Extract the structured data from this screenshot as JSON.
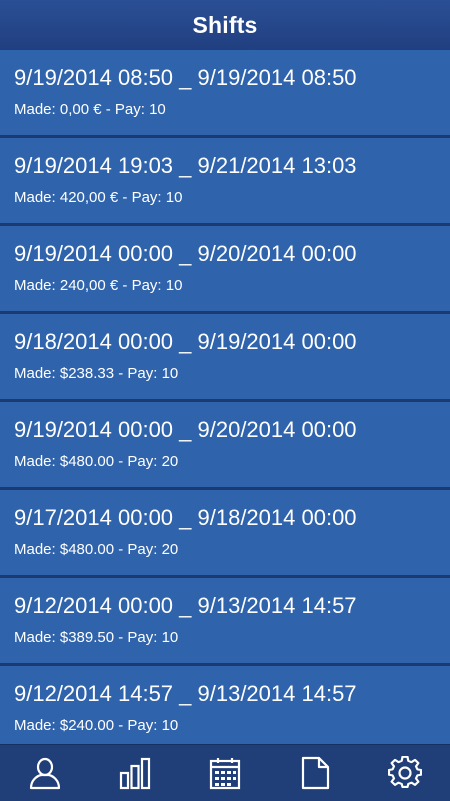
{
  "header": {
    "title": "Shifts"
  },
  "shifts": [
    {
      "range": "9/19/2014 08:50 _ 9/19/2014 08:50",
      "made": "Made: 0,00 € - Pay: 10"
    },
    {
      "range": "9/19/2014 19:03 _ 9/21/2014 13:03",
      "made": "Made: 420,00 € - Pay: 10"
    },
    {
      "range": "9/19/2014 00:00 _ 9/20/2014 00:00",
      "made": "Made: 240,00 € - Pay: 10"
    },
    {
      "range": "9/18/2014 00:00 _ 9/19/2014 00:00",
      "made": "Made: $238.33 - Pay: 10"
    },
    {
      "range": "9/19/2014 00:00 _ 9/20/2014 00:00",
      "made": "Made: $480.00 - Pay: 20"
    },
    {
      "range": "9/17/2014 00:00 _ 9/18/2014 00:00",
      "made": "Made: $480.00 - Pay: 20"
    },
    {
      "range": "9/12/2014 00:00 _ 9/13/2014 14:57",
      "made": "Made: $389.50 - Pay: 10"
    },
    {
      "range": "9/12/2014 14:57 _ 9/13/2014 14:57",
      "made": "Made: $240.00 - Pay: 10"
    }
  ],
  "bottom_nav": [
    {
      "icon": "person-icon"
    },
    {
      "icon": "bar-chart-icon"
    },
    {
      "icon": "calendar-icon"
    },
    {
      "icon": "document-icon"
    },
    {
      "icon": "gear-icon"
    }
  ],
  "colors": {
    "header_bg": "#203f80",
    "row_bg": "#2f63ab",
    "separator": "#1b3a70",
    "bottom_bar_bg": "#203e78",
    "text": "#ffffff"
  }
}
